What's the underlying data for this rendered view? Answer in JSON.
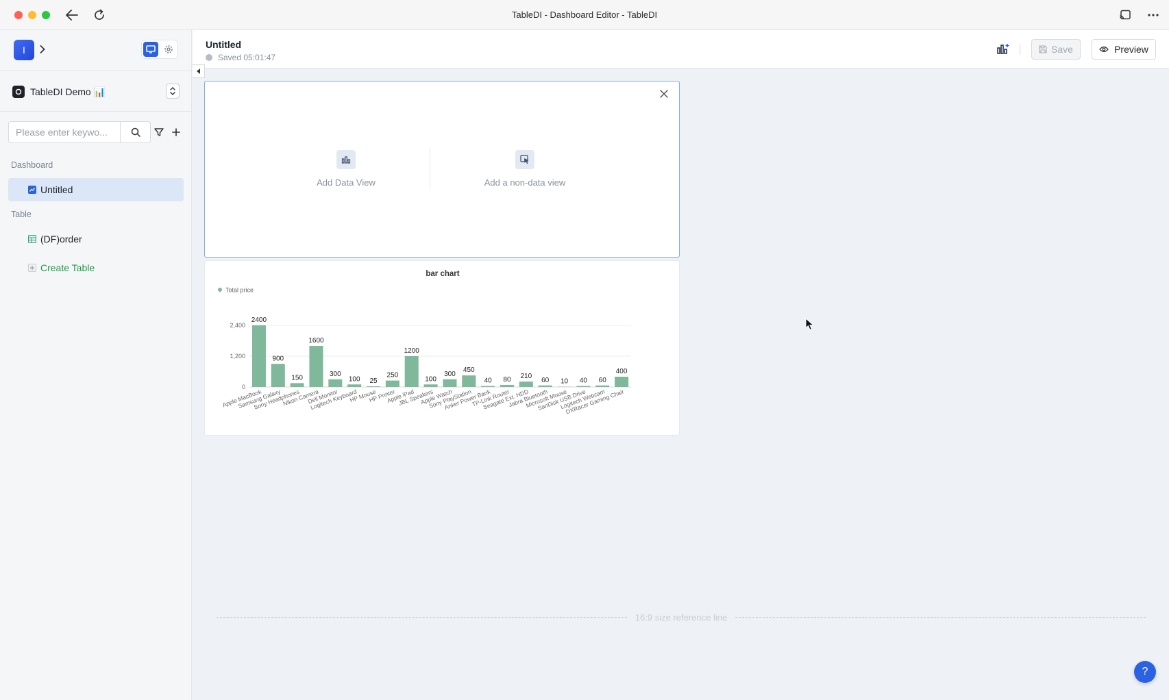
{
  "window": {
    "title": "TableDI - Dashboard Editor - TableDI"
  },
  "sidebar": {
    "app_initial": "I",
    "project_name": "TableDI Demo 📊",
    "search_placeholder": "Please enter keywo...",
    "sections": {
      "dashboard_label": "Dashboard",
      "table_label": "Table"
    },
    "dashboard_items": [
      {
        "label": "Untitled"
      }
    ],
    "table_items": [
      {
        "label": "(DF)order"
      }
    ],
    "create_table_label": "Create Table"
  },
  "header": {
    "title": "Untitled",
    "saved_text": "Saved 05:01:47",
    "save_label": "Save",
    "preview_label": "Preview"
  },
  "add_view_card": {
    "data_view_label": "Add Data View",
    "non_data_view_label": "Add a non-data view"
  },
  "chart_data": {
    "type": "bar",
    "title": "bar chart",
    "legend": "top-left",
    "series": [
      {
        "name": "Total price",
        "color": "#7fb89a",
        "values": [
          2400,
          900,
          150,
          1600,
          300,
          100,
          25,
          250,
          1200,
          100,
          300,
          450,
          40,
          80,
          210,
          60,
          10,
          40,
          60,
          400
        ]
      }
    ],
    "categories": [
      "Apple MacBook",
      "Samsung Galaxy",
      "Sony Headphones",
      "Nikon Camera",
      "Dell Monitor",
      "Logitech Keyboard",
      "HP Mouse",
      "HP Printer",
      "Apple iPad",
      "JBL Speakers",
      "Apple Watch",
      "Sony PlayStation",
      "Anker Power Bank",
      "TP-Link Router",
      "Seagate Ext. HDD",
      "Jabra Bluetooth",
      "Microsoft Mouse",
      "SanDisk USB Drive",
      "Logitech Webcam",
      "DXRacer Gaming Chair"
    ],
    "yticks": [
      "0",
      "1,200",
      "2,400"
    ],
    "ylim": [
      0,
      2400
    ],
    "grid": true
  },
  "canvas": {
    "reference_line_label": "16:9 size reference line"
  },
  "help": {
    "label": "?"
  },
  "colors": {
    "accent": "#2a62e3",
    "create_table_green": "#1a9c44",
    "bar": "#7fb89a"
  }
}
